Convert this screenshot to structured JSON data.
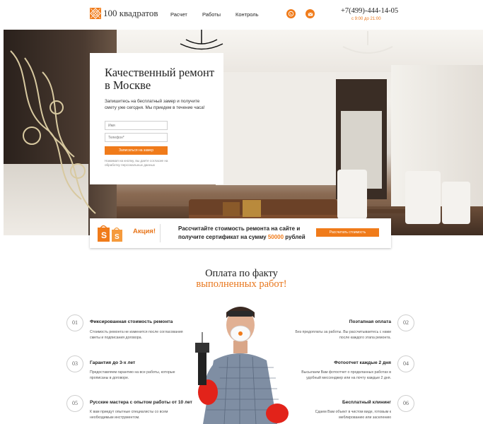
{
  "header": {
    "logo_text": "100 квадратов",
    "nav": [
      {
        "label": "Расчет"
      },
      {
        "label": "Работы"
      },
      {
        "label": "Контроль"
      }
    ],
    "phone": "+7(499)-444-14-05",
    "hours": "с 9:00 до 21:00",
    "social_icons": [
      "whatsapp-icon",
      "mail-icon"
    ]
  },
  "hero": {
    "form": {
      "title": "Качественный ремонт в Москве",
      "subtitle": "Запишитесь на бесплатный замер и получите смету уже сегодня. Мы приедем в течение часа!",
      "name_placeholder": "Имя",
      "phone_placeholder": "Телефон*",
      "submit_label": "Записаться на замер",
      "note": "Нажимая на кнопку, вы даете согласие на обработку персональных данных"
    }
  },
  "promo": {
    "label": "Акция!",
    "text_before": "Рассчитайте стоимость ремонта на сайте и получите сертификат на сумму ",
    "amount": "50000",
    "text_after": " рублей",
    "button_label": "Рассчитать стоимость"
  },
  "payment": {
    "title_line1": "Оплата по факту",
    "title_line2": "выполненных работ!",
    "features": [
      {
        "num": "01",
        "title": "Фиксированная стоимость ремонта",
        "desc": "Стоимость ремонта не изменится после согласования сметы и подписания договора."
      },
      {
        "num": "02",
        "title": "Поэтапная оплата",
        "desc": "Без предоплаты за работы. Вы рассчитываетесь с нами после каждого этапа ремонта."
      },
      {
        "num": "03",
        "title": "Гарантия до 3-х лет",
        "desc": "Предоставляем гарантию на все работы, которые прописаны в договоре."
      },
      {
        "num": "04",
        "title": "Фотоотчет каждые 2 дня",
        "desc": "Высылаем Вам фотоотчет о проделанных работах в удобный мессенджер или на почту каждые 2 дня."
      },
      {
        "num": "05",
        "title": "Русские мастера с опытом работы от 10 лет",
        "desc": "К вам приедут опытные специалисты со всем необходимым инструментом."
      },
      {
        "num": "06",
        "title": "Бесплатный клининг",
        "desc": "Сдаем Вам объект в чистом виде, готовым к меблированию или заселению"
      }
    ]
  },
  "colors": {
    "accent": "#f07b1a"
  }
}
